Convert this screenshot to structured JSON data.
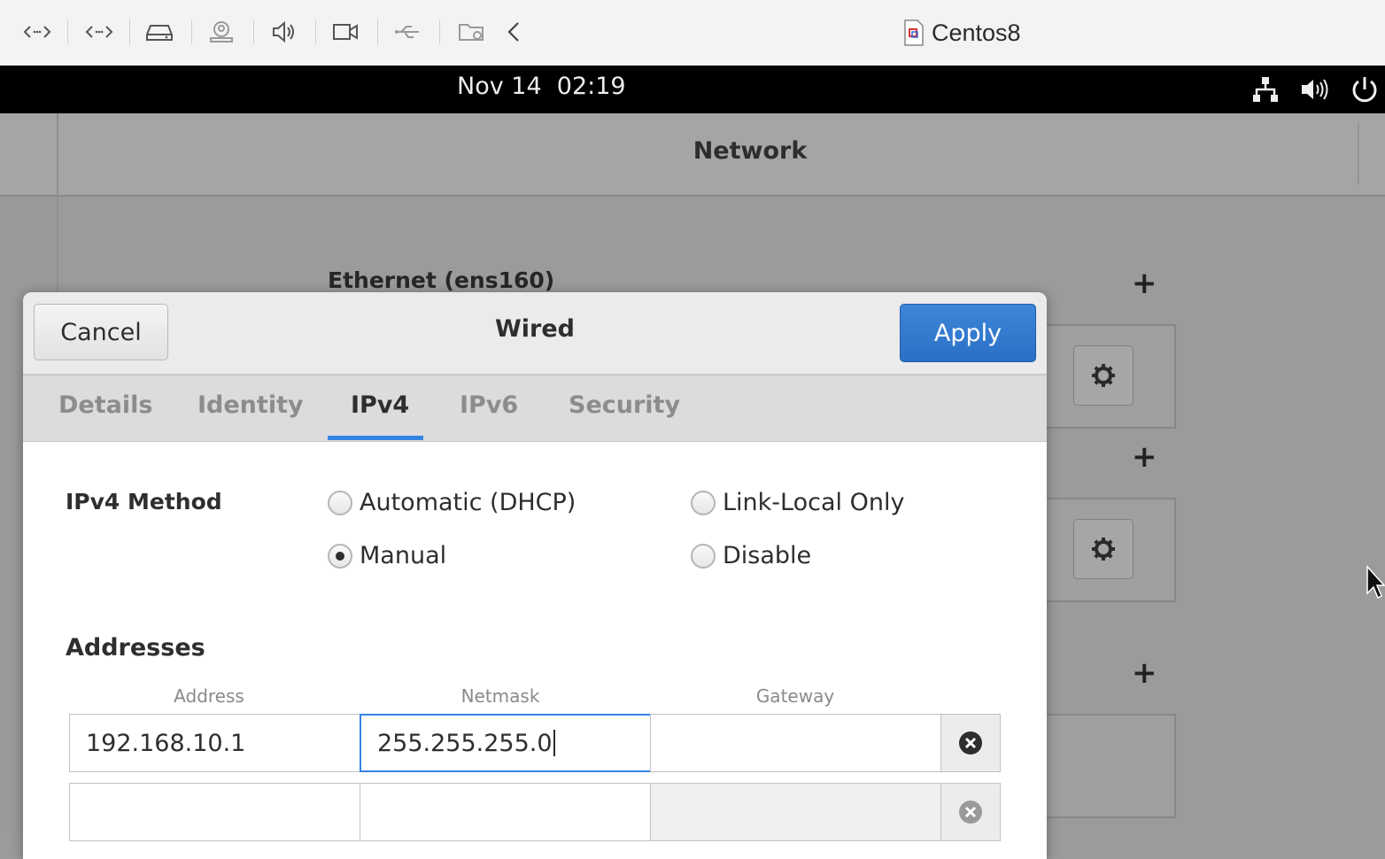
{
  "vm_window": {
    "title": "Centos8",
    "toolbar_icons": [
      "code-icon",
      "code-icon",
      "drive-icon",
      "user-lock-icon",
      "speaker-icon",
      "camera-icon",
      "usb-icon",
      "folder-share-icon",
      "chevron-left-icon"
    ]
  },
  "top_bar": {
    "clock": "Nov 14  02:19",
    "icons": [
      "network-icon",
      "volume-icon",
      "power-icon"
    ]
  },
  "settings": {
    "title": "Network",
    "section_title": "Ethernet (ens160)"
  },
  "dialog": {
    "title": "Wired",
    "cancel_label": "Cancel",
    "apply_label": "Apply",
    "tabs": [
      {
        "label": "Details",
        "active": false
      },
      {
        "label": "Identity",
        "active": false
      },
      {
        "label": "IPv4",
        "active": true
      },
      {
        "label": "IPv6",
        "active": false
      },
      {
        "label": "Security",
        "active": false
      }
    ],
    "ipv4": {
      "method_label": "IPv4 Method",
      "methods": [
        {
          "label": "Automatic (DHCP)",
          "checked": false
        },
        {
          "label": "Link-Local Only",
          "checked": false
        },
        {
          "label": "Manual",
          "checked": true
        },
        {
          "label": "Disable",
          "checked": false
        }
      ],
      "addresses_label": "Addresses",
      "columns": {
        "address": "Address",
        "netmask": "Netmask",
        "gateway": "Gateway"
      },
      "rows": [
        {
          "address": "192.168.10.1",
          "netmask": "255.255.255.0",
          "gateway": ""
        },
        {
          "address": "",
          "netmask": "",
          "gateway": ""
        }
      ]
    }
  },
  "colors": {
    "accent": "#3584e4",
    "apply_button": "#2f75cc",
    "top_bar": "#000000"
  }
}
